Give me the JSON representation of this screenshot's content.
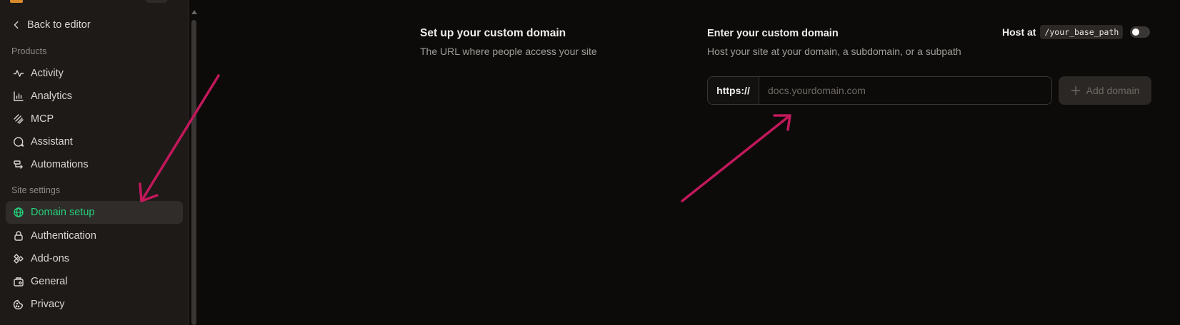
{
  "sidebar": {
    "back_label": "Back to editor",
    "section_products": "Products",
    "products": [
      {
        "label": "Activity",
        "icon": "activity-icon"
      },
      {
        "label": "Analytics",
        "icon": "analytics-icon"
      },
      {
        "label": "MCP",
        "icon": "mcp-icon"
      },
      {
        "label": "Assistant",
        "icon": "assistant-icon"
      },
      {
        "label": "Automations",
        "icon": "automations-icon"
      }
    ],
    "section_site_settings": "Site settings",
    "settings": [
      {
        "label": "Domain setup",
        "icon": "globe-icon",
        "active": true
      },
      {
        "label": "Authentication",
        "icon": "lock-icon"
      },
      {
        "label": "Add-ons",
        "icon": "add-ons-icon"
      },
      {
        "label": "General",
        "icon": "general-icon"
      },
      {
        "label": "Privacy",
        "icon": "privacy-icon"
      }
    ]
  },
  "main": {
    "section_title": "Set up your custom domain",
    "section_subtitle": "The URL where people access your site",
    "form_title": "Enter your custom domain",
    "form_subtitle": "Host your site at your domain, a subdomain, or a subpath",
    "host_at_label": "Host at",
    "base_path_chip": "/your_base_path",
    "toggle_on": false,
    "url_prefix": "https://",
    "domain_value": "",
    "domain_placeholder": "docs.yourdomain.com",
    "add_button_label": "Add domain"
  },
  "colors": {
    "accent_active": "#26d07c",
    "annotation_arrow": "#c2185b"
  }
}
